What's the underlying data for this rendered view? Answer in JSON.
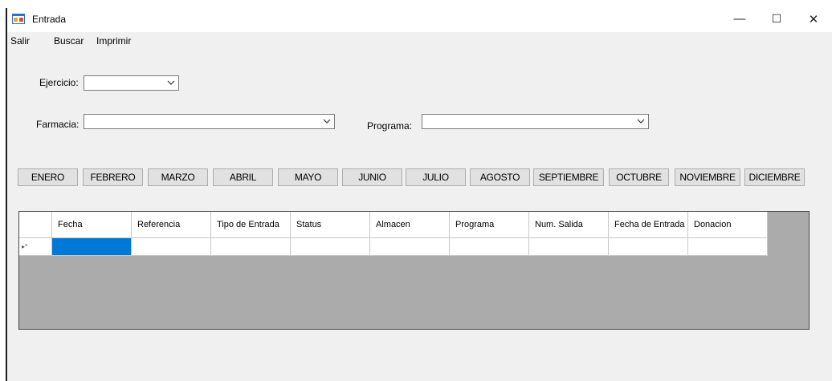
{
  "window": {
    "title": "Entrada",
    "controls": {
      "minimize": "—",
      "maximize": "☐",
      "close": "✕"
    }
  },
  "menu": [
    "Salir",
    "Buscar",
    "Imprimir"
  ],
  "form": {
    "ejercicio_label": "Ejercicio:",
    "ejercicio_value": "",
    "farmacia_label": "Farmacia:",
    "farmacia_value": "",
    "programa_label": "Programa:",
    "programa_value": ""
  },
  "months": [
    "ENERO",
    "FEBRERO",
    "MARZO",
    "ABRIL",
    "MAYO",
    "JUNIO",
    "JULIO",
    "AGOSTO",
    "SEPTIEMBRE",
    "OCTUBRE",
    "NOVIEMBRE",
    "DICIEMBRE"
  ],
  "grid": {
    "columns": [
      "Fecha",
      "Referencia",
      "Tipo de Entrada",
      "Status",
      "Almacen",
      "Programa",
      "Num. Salida",
      "Fecha de Entrada",
      "Donacion"
    ],
    "new_row_marker": "▸*"
  },
  "colors": {
    "selected_cell": "#0078d7",
    "grid_background": "#ababab",
    "window_bg": "#f0f0f0"
  }
}
